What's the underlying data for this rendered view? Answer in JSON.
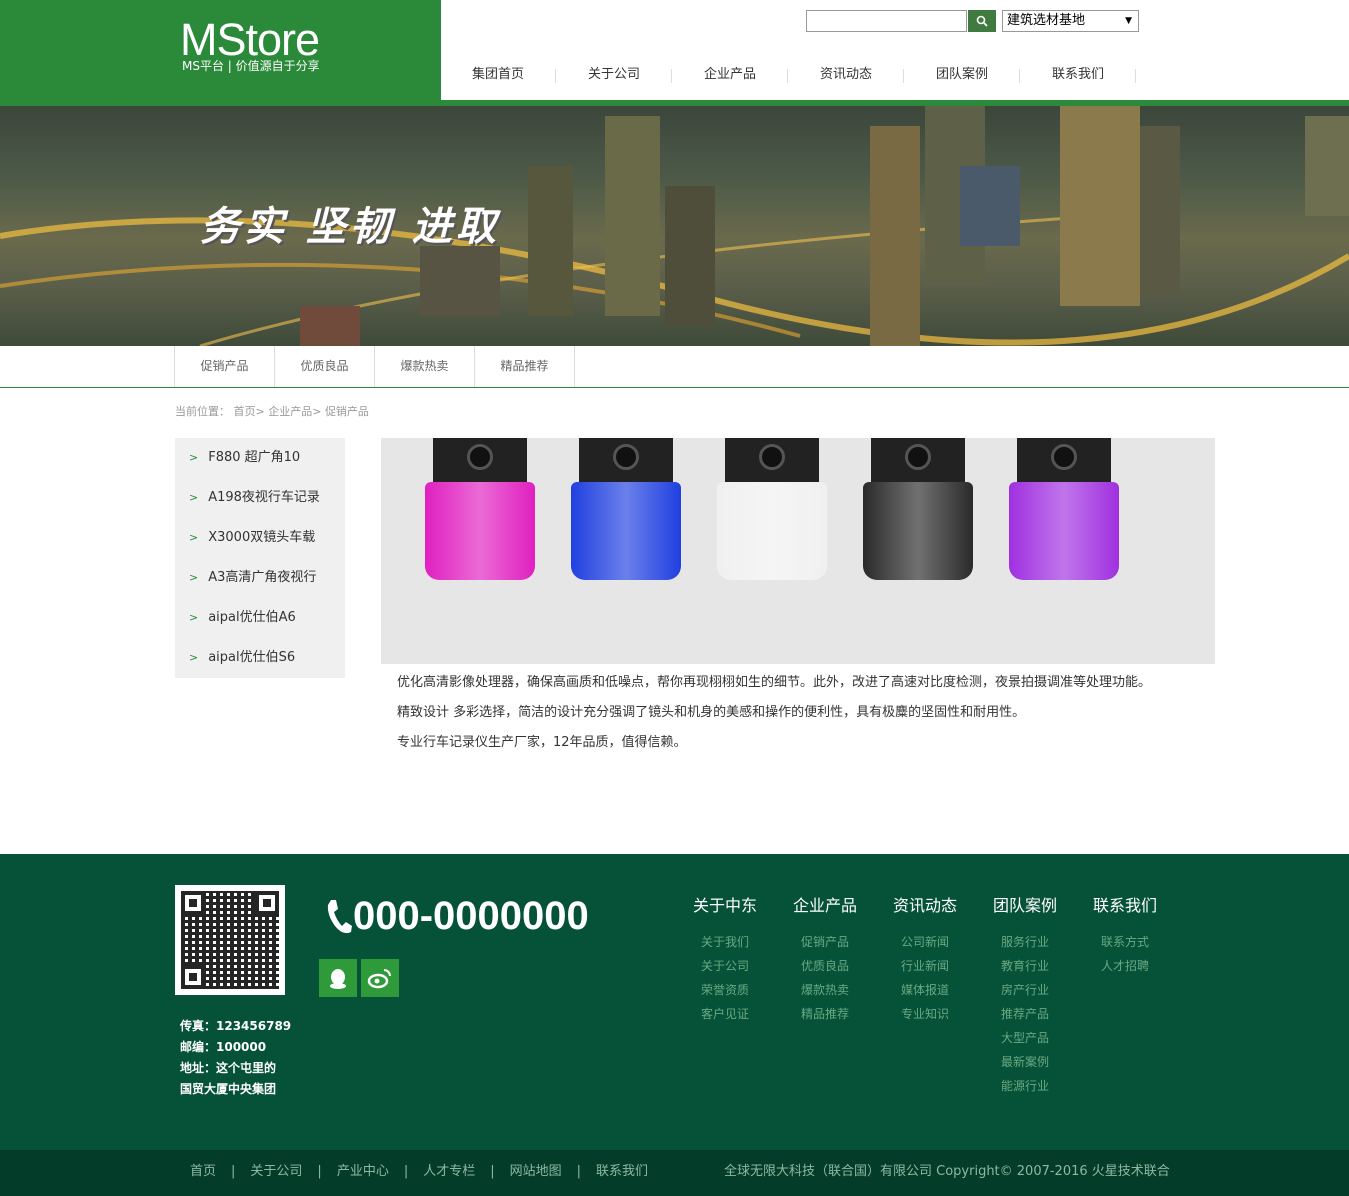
{
  "header": {
    "logo_title": "MStore",
    "logo_sub": "MS平台 | 价值源自于分享",
    "search_placeholder": "",
    "site_select": "建筑选材基地",
    "nav": [
      "集团首页",
      "关于公司",
      "企业产品",
      "资讯动态",
      "团队案例",
      "联系我们"
    ]
  },
  "banner": {
    "slogan": "务实  坚韧  进取"
  },
  "subnav": [
    "促销产品",
    "优质良品",
    "爆款热卖",
    "精品推荐"
  ],
  "breadcrumb": {
    "prefix": "当前位置：",
    "home": "首页",
    "sep": ">",
    "level1": "企业产品",
    "level2": "促销产品"
  },
  "sidebar": [
    "F880 超广角10",
    "A198夜视行车记录",
    "X3000双镜头车载",
    "A3高清广角夜视行",
    "aipal优仕伯A6",
    "aipal优仕伯S6"
  ],
  "product": {
    "colors": [
      "#e020c0",
      "#2040e0",
      "#f0f0f0",
      "#2a2a2a",
      "#a030e0"
    ],
    "desc": [
      "优化高清影像处理器，确保高画质和低噪点，帮你再现栩栩如生的细节。此外，改进了高速对比度检测，夜景拍摄调准等处理功能。",
      "精致设计 多彩选择，简洁的设计充分强调了镜头和机身的美感和操作的便利性，具有极麋的坚固性和耐用性。",
      "专业行车记录仪生产厂家，12年品质，值得信赖。"
    ]
  },
  "footer": {
    "fax": "传真：123456789",
    "zip": "邮编：100000",
    "addr1": "地址：这个屯里的",
    "addr2": "国贸大厦中央集团",
    "phone": "000-0000000",
    "cols": [
      {
        "title": "关于中东",
        "links": [
          "关于我们",
          "关于公司",
          "荣誉资质",
          "客户见证"
        ]
      },
      {
        "title": "企业产品",
        "links": [
          "促销产品",
          "优质良品",
          "爆款热卖",
          "精品推荐"
        ]
      },
      {
        "title": "资讯动态",
        "links": [
          "公司新闻",
          "行业新闻",
          "媒体报道",
          "专业知识"
        ]
      },
      {
        "title": "团队案例",
        "links": [
          "服务行业",
          "教育行业",
          "房产行业",
          "推荐产品",
          "大型产品",
          "最新案例",
          "能源行业"
        ]
      },
      {
        "title": "联系我们",
        "links": [
          "联系方式",
          "人才招聘"
        ]
      }
    ]
  },
  "bottom": {
    "links": [
      "首页",
      "关于公司",
      "产业中心",
      "人才专栏",
      "网站地图",
      "联系我们"
    ],
    "separator": "|",
    "copyright": "全球无限大科技（联合国）有限公司 Copyright© 2007-2016 火星技术联合"
  },
  "colors": {
    "brand_green": "#2a8a3a",
    "footer_green": "#055238",
    "bottom_green": "#033d2a"
  }
}
